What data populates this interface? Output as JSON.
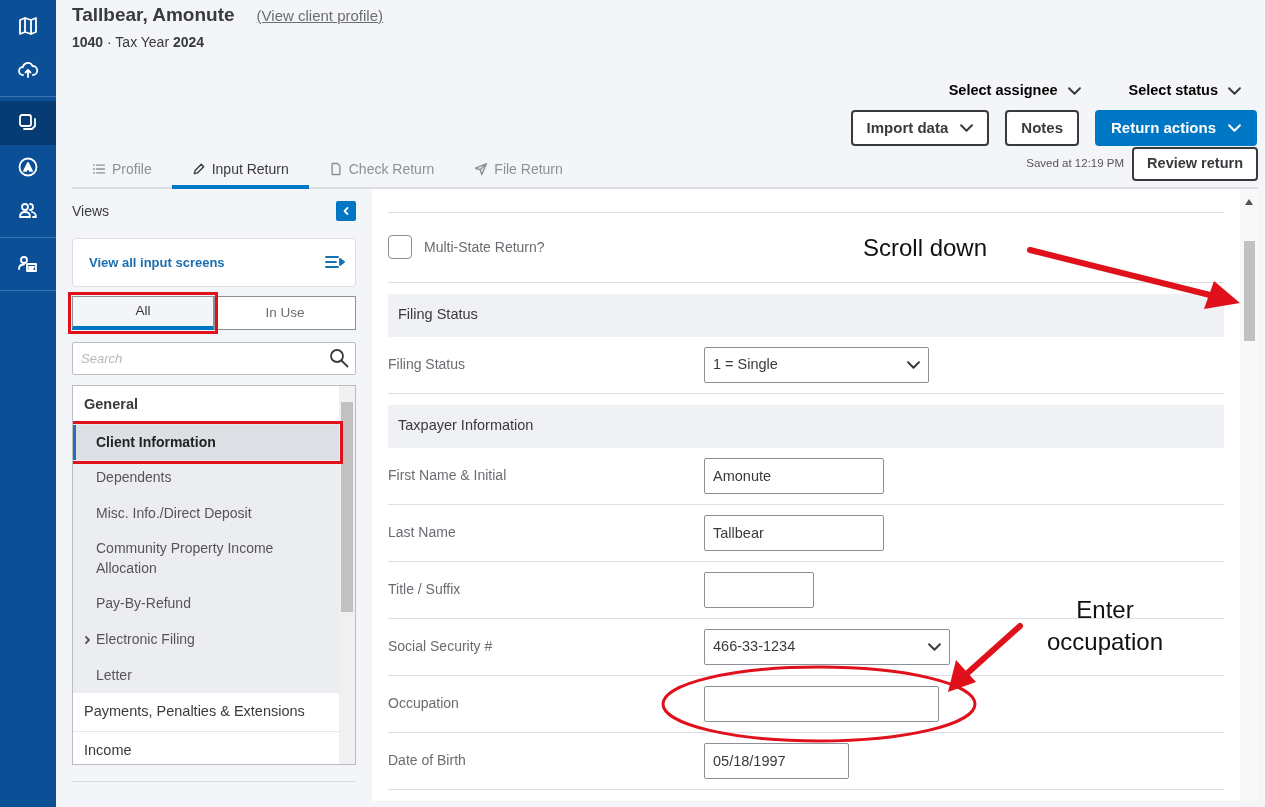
{
  "rail": {
    "groups": [
      [
        {
          "kind": "map",
          "selected": false
        },
        {
          "kind": "cloud",
          "selected": false
        }
      ],
      [
        {
          "kind": "copies",
          "selected": true
        },
        {
          "kind": "logo",
          "selected": false
        },
        {
          "kind": "people",
          "selected": false
        }
      ],
      [
        {
          "kind": "contact",
          "selected": false
        }
      ]
    ]
  },
  "header": {
    "client_name": "Tallbear, Amonute",
    "profile_link": "(View client profile)",
    "subtitle": "**1040** · Tax Year **2024**"
  },
  "selectors": [
    "Select assignee",
    "Select status"
  ],
  "actions": [
    {
      "label": "Import data",
      "kind": "outline",
      "dropdown": true
    },
    {
      "label": "Notes",
      "kind": "outline",
      "dropdown": false
    },
    {
      "label": "Return actions",
      "kind": "primary",
      "dropdown": true
    }
  ],
  "saved": "Saved at 12:19 PM",
  "review_button": "Review return",
  "tabs": [
    {
      "label": "Profile",
      "selected": false
    },
    {
      "label": "Input Return",
      "selected": true
    },
    {
      "label": "Check Return",
      "selected": false
    },
    {
      "label": "File Return",
      "selected": false
    }
  ],
  "views": {
    "title": "Views",
    "view_all": "View all input screens",
    "filters": [
      {
        "label": "All",
        "selected": true,
        "highlighted": true
      },
      {
        "label": "In Use",
        "selected": false,
        "highlighted": false
      }
    ],
    "search": {
      "placeholder": "Search"
    },
    "tree": [
      {
        "label": "General",
        "expanded": true,
        "children": [
          {
            "label": "Client Information",
            "selected": true,
            "highlighted": true,
            "expandable": false
          },
          {
            "label": "Dependents",
            "selected": false,
            "highlighted": false,
            "expandable": false
          },
          {
            "label": "Misc. Info./Direct Deposit",
            "selected": false,
            "highlighted": false,
            "expandable": false
          },
          {
            "label": "Community Property Income Allocation",
            "selected": false,
            "highlighted": false,
            "expandable": false
          },
          {
            "label": "Pay-By-Refund",
            "selected": false,
            "highlighted": false,
            "expandable": false
          },
          {
            "label": "Electronic Filing",
            "selected": false,
            "highlighted": false,
            "expandable": true
          },
          {
            "label": "Letter",
            "selected": false,
            "highlighted": false,
            "expandable": false
          }
        ]
      },
      {
        "label": "Payments, Penalties & Extensions",
        "expanded": false
      },
      {
        "label": "Income",
        "expanded": false
      }
    ]
  },
  "form": {
    "rows": [
      {
        "kind": "checkbox",
        "label": "Multi-State Return?",
        "checked": false
      },
      {
        "kind": "section",
        "label": "Filing Status"
      },
      {
        "kind": "select",
        "label": "Filing Status",
        "value": "1 = Single"
      },
      {
        "kind": "section",
        "label": "Taxpayer Information"
      },
      {
        "kind": "text",
        "label": "First Name & Initial",
        "value": "Amonute",
        "circled": false
      },
      {
        "kind": "text",
        "label": "Last Name",
        "value": "Tallbear",
        "circled": false
      },
      {
        "kind": "text",
        "label": "Title / Suffix",
        "value": "",
        "circled": false
      },
      {
        "kind": "select",
        "label": "Social Security #",
        "value": "466-33-1234"
      },
      {
        "kind": "text",
        "label": "Occupation",
        "value": "",
        "circled": true
      },
      {
        "kind": "text",
        "label": "Date of Birth",
        "value": "05/18/1997",
        "circled": false
      }
    ]
  },
  "annotations": [
    {
      "kind": "scroll",
      "text": "Scroll down"
    },
    {
      "kind": "field",
      "text": "Enter occupation"
    }
  ]
}
